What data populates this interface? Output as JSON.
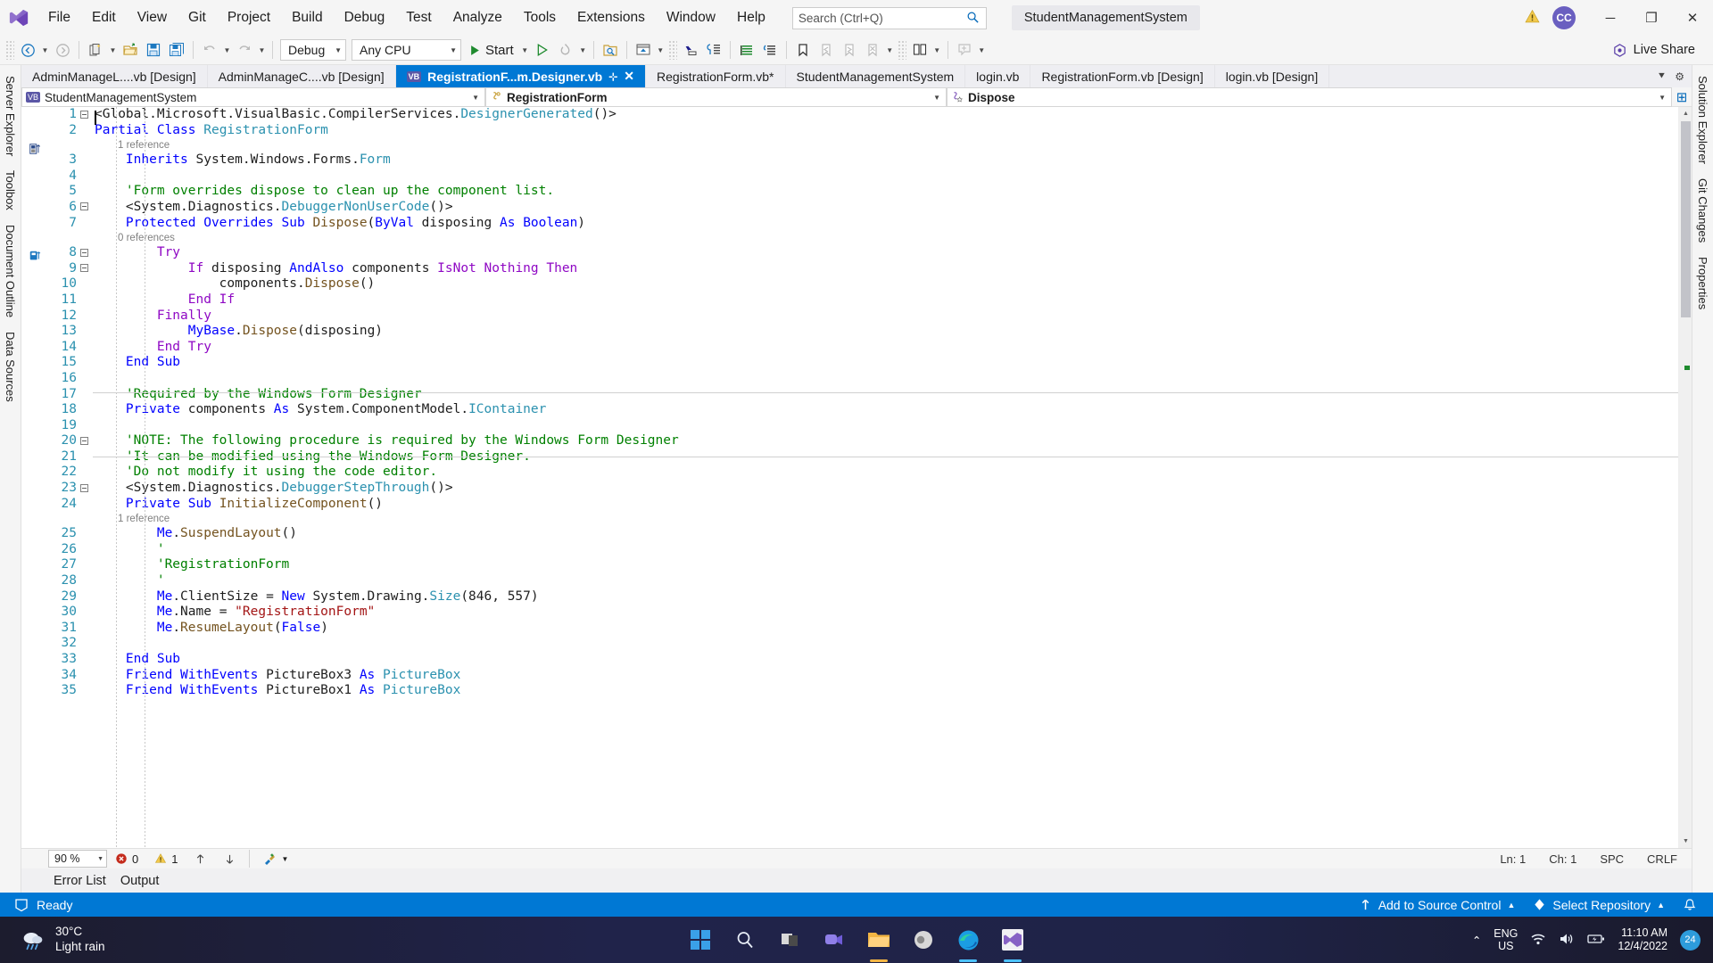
{
  "titlebar": {
    "menus": [
      "File",
      "Edit",
      "View",
      "Git",
      "Project",
      "Build",
      "Debug",
      "Test",
      "Analyze",
      "Tools",
      "Extensions",
      "Window",
      "Help"
    ],
    "search_placeholder": "Search (Ctrl+Q)",
    "solution_name": "StudentManagementSystem",
    "avatar_initials": "CC",
    "minimize": "─",
    "maximize": "❐",
    "close": "✕"
  },
  "toolbar": {
    "config_value": "Debug",
    "platform_value": "Any CPU",
    "start_label": "Start",
    "live_share_label": "Live Share"
  },
  "tabs": [
    {
      "label": "AdminManageL....vb [Design]",
      "active": false,
      "icon": false
    },
    {
      "label": "AdminManageC....vb [Design]",
      "active": false,
      "icon": false
    },
    {
      "label": "RegistrationF...m.Designer.vb",
      "active": true,
      "icon": true
    },
    {
      "label": "RegistrationForm.vb*",
      "active": false,
      "icon": false
    },
    {
      "label": "StudentManagementSystem",
      "active": false,
      "icon": false
    },
    {
      "label": "login.vb",
      "active": false,
      "icon": false
    },
    {
      "label": "RegistrationForm.vb [Design]",
      "active": false,
      "icon": false
    },
    {
      "label": "login.vb [Design]",
      "active": false,
      "icon": false
    }
  ],
  "navbar": {
    "project": "StudentManagementSystem",
    "type": "RegistrationForm",
    "member": "Dispose"
  },
  "left_dock": [
    "Server Explorer",
    "Toolbox",
    "Document Outline",
    "Data Sources"
  ],
  "right_dock": [
    "Solution Explorer",
    "Git Changes",
    "Properties"
  ],
  "editor": {
    "lines": [
      {
        "n": 1,
        "fold": "minus",
        "ref": null,
        "tokens": [
          {
            "t": "<Global.Microsoft.VisualBasic.CompilerServices.",
            "c": "pln"
          },
          {
            "t": "DesignerGenerated",
            "c": "typ"
          },
          {
            "t": "()>",
            "c": "pln"
          }
        ]
      },
      {
        "n": 2,
        "fold": null,
        "ref": "1 reference",
        "tokens": [
          {
            "t": "Partial ",
            "c": "kw"
          },
          {
            "t": "Class ",
            "c": "kw"
          },
          {
            "t": "RegistrationForm",
            "c": "typ"
          }
        ]
      },
      {
        "n": 3,
        "fold": null,
        "ref": null,
        "tokens": [
          {
            "t": "    ",
            "c": "pln"
          },
          {
            "t": "Inherits ",
            "c": "kw"
          },
          {
            "t": "System.Windows.Forms.",
            "c": "pln"
          },
          {
            "t": "Form",
            "c": "typ"
          }
        ]
      },
      {
        "n": 4,
        "fold": null,
        "ref": null,
        "tokens": []
      },
      {
        "n": 5,
        "fold": null,
        "ref": null,
        "tokens": [
          {
            "t": "    'Form overrides dispose to clean up the component list.",
            "c": "cmt"
          }
        ]
      },
      {
        "n": 6,
        "fold": "minus",
        "ref": null,
        "tokens": [
          {
            "t": "    <System.Diagnostics.",
            "c": "pln"
          },
          {
            "t": "DebuggerNonUserCode",
            "c": "typ"
          },
          {
            "t": "()>",
            "c": "pln"
          }
        ]
      },
      {
        "n": 7,
        "fold": null,
        "ref": "0 references",
        "tokens": [
          {
            "t": "    ",
            "c": "pln"
          },
          {
            "t": "Protected Overrides Sub ",
            "c": "kw"
          },
          {
            "t": "Dispose",
            "c": "mth"
          },
          {
            "t": "(",
            "c": "pln"
          },
          {
            "t": "ByVal ",
            "c": "kw"
          },
          {
            "t": "disposing ",
            "c": "pln"
          },
          {
            "t": "As ",
            "c": "kw"
          },
          {
            "t": "Boolean",
            "c": "kw"
          },
          {
            "t": ")",
            "c": "pln"
          }
        ]
      },
      {
        "n": 8,
        "fold": "minus",
        "ref": null,
        "tokens": [
          {
            "t": "        ",
            "c": "pln"
          },
          {
            "t": "Try",
            "c": "kwp"
          }
        ]
      },
      {
        "n": 9,
        "fold": "minus",
        "ref": null,
        "tokens": [
          {
            "t": "            ",
            "c": "pln"
          },
          {
            "t": "If ",
            "c": "kwp"
          },
          {
            "t": "disposing ",
            "c": "pln"
          },
          {
            "t": "AndAlso ",
            "c": "kw"
          },
          {
            "t": "components ",
            "c": "pln"
          },
          {
            "t": "IsNot Nothing Then",
            "c": "kwp"
          }
        ]
      },
      {
        "n": 10,
        "fold": null,
        "ref": null,
        "tokens": [
          {
            "t": "                components.",
            "c": "pln"
          },
          {
            "t": "Dispose",
            "c": "mth"
          },
          {
            "t": "()",
            "c": "pln"
          }
        ]
      },
      {
        "n": 11,
        "fold": null,
        "ref": null,
        "tokens": [
          {
            "t": "            ",
            "c": "pln"
          },
          {
            "t": "End If",
            "c": "kwp"
          }
        ]
      },
      {
        "n": 12,
        "fold": null,
        "ref": null,
        "tokens": [
          {
            "t": "        ",
            "c": "pln"
          },
          {
            "t": "Finally",
            "c": "kwp"
          }
        ]
      },
      {
        "n": 13,
        "fold": null,
        "ref": null,
        "tokens": [
          {
            "t": "            ",
            "c": "pln"
          },
          {
            "t": "MyBase",
            "c": "kw"
          },
          {
            "t": ".",
            "c": "pln"
          },
          {
            "t": "Dispose",
            "c": "mth"
          },
          {
            "t": "(disposing)",
            "c": "pln"
          }
        ]
      },
      {
        "n": 14,
        "fold": null,
        "ref": null,
        "tokens": [
          {
            "t": "        ",
            "c": "pln"
          },
          {
            "t": "End Try",
            "c": "kwp"
          }
        ]
      },
      {
        "n": 15,
        "fold": null,
        "ref": null,
        "tokens": [
          {
            "t": "    ",
            "c": "pln"
          },
          {
            "t": "End Sub",
            "c": "kw"
          }
        ]
      },
      {
        "n": 16,
        "fold": null,
        "ref": null,
        "tokens": []
      },
      {
        "n": 17,
        "fold": null,
        "ref": null,
        "tokens": [
          {
            "t": "    'Required by the Windows Form Designer",
            "c": "cmt"
          }
        ]
      },
      {
        "n": 18,
        "fold": null,
        "ref": null,
        "tokens": [
          {
            "t": "    ",
            "c": "pln"
          },
          {
            "t": "Private ",
            "c": "kw"
          },
          {
            "t": "components ",
            "c": "pln"
          },
          {
            "t": "As ",
            "c": "kw"
          },
          {
            "t": "System.ComponentModel.",
            "c": "pln"
          },
          {
            "t": "IContainer",
            "c": "typ"
          }
        ]
      },
      {
        "n": 19,
        "fold": null,
        "ref": null,
        "tokens": []
      },
      {
        "n": 20,
        "fold": "minus",
        "ref": null,
        "tokens": [
          {
            "t": "    'NOTE: The following procedure is required by the Windows Form Designer",
            "c": "cmt"
          }
        ]
      },
      {
        "n": 21,
        "fold": null,
        "ref": null,
        "tokens": [
          {
            "t": "    'It can be modified using the Windows Form Designer.",
            "c": "cmt"
          }
        ]
      },
      {
        "n": 22,
        "fold": null,
        "ref": null,
        "tokens": [
          {
            "t": "    'Do not modify it using the code editor.",
            "c": "cmt"
          }
        ]
      },
      {
        "n": 23,
        "fold": "minus",
        "ref": null,
        "tokens": [
          {
            "t": "    <System.Diagnostics.",
            "c": "pln"
          },
          {
            "t": "DebuggerStepThrough",
            "c": "typ"
          },
          {
            "t": "()>",
            "c": "pln"
          }
        ]
      },
      {
        "n": 24,
        "fold": null,
        "ref": "1 reference",
        "tokens": [
          {
            "t": "    ",
            "c": "pln"
          },
          {
            "t": "Private Sub ",
            "c": "kw"
          },
          {
            "t": "InitializeComponent",
            "c": "mth"
          },
          {
            "t": "()",
            "c": "pln"
          }
        ]
      },
      {
        "n": 25,
        "fold": null,
        "ref": null,
        "tokens": [
          {
            "t": "        ",
            "c": "pln"
          },
          {
            "t": "Me",
            "c": "kw"
          },
          {
            "t": ".",
            "c": "pln"
          },
          {
            "t": "SuspendLayout",
            "c": "mth"
          },
          {
            "t": "()",
            "c": "pln"
          }
        ]
      },
      {
        "n": 26,
        "fold": null,
        "ref": null,
        "tokens": [
          {
            "t": "        '",
            "c": "cmt"
          }
        ]
      },
      {
        "n": 27,
        "fold": null,
        "ref": null,
        "tokens": [
          {
            "t": "        'RegistrationForm",
            "c": "cmt"
          }
        ]
      },
      {
        "n": 28,
        "fold": null,
        "ref": null,
        "tokens": [
          {
            "t": "        '",
            "c": "cmt"
          }
        ]
      },
      {
        "n": 29,
        "fold": null,
        "ref": null,
        "tokens": [
          {
            "t": "        ",
            "c": "pln"
          },
          {
            "t": "Me",
            "c": "kw"
          },
          {
            "t": ".ClientSize = ",
            "c": "pln"
          },
          {
            "t": "New ",
            "c": "kw"
          },
          {
            "t": "System.Drawing.",
            "c": "pln"
          },
          {
            "t": "Size",
            "c": "typ"
          },
          {
            "t": "(846, 557)",
            "c": "pln"
          }
        ]
      },
      {
        "n": 30,
        "fold": null,
        "ref": null,
        "tokens": [
          {
            "t": "        ",
            "c": "pln"
          },
          {
            "t": "Me",
            "c": "kw"
          },
          {
            "t": ".Name = ",
            "c": "pln"
          },
          {
            "t": "\"RegistrationForm\"",
            "c": "str"
          }
        ]
      },
      {
        "n": 31,
        "fold": null,
        "ref": null,
        "tokens": [
          {
            "t": "        ",
            "c": "pln"
          },
          {
            "t": "Me",
            "c": "kw"
          },
          {
            "t": ".",
            "c": "pln"
          },
          {
            "t": "ResumeLayout",
            "c": "mth"
          },
          {
            "t": "(",
            "c": "pln"
          },
          {
            "t": "False",
            "c": "kw"
          },
          {
            "t": ")",
            "c": "pln"
          }
        ]
      },
      {
        "n": 32,
        "fold": null,
        "ref": null,
        "tokens": []
      },
      {
        "n": 33,
        "fold": null,
        "ref": null,
        "tokens": [
          {
            "t": "    ",
            "c": "pln"
          },
          {
            "t": "End Sub",
            "c": "kw"
          }
        ]
      },
      {
        "n": 34,
        "fold": null,
        "ref": null,
        "tokens": [
          {
            "t": "    ",
            "c": "pln"
          },
          {
            "t": "Friend WithEvents ",
            "c": "kw"
          },
          {
            "t": "PictureBox3 ",
            "c": "pln"
          },
          {
            "t": "As ",
            "c": "kw"
          },
          {
            "t": "PictureBox",
            "c": "typ"
          }
        ]
      },
      {
        "n": 35,
        "fold": null,
        "ref": null,
        "tokens": [
          {
            "t": "    ",
            "c": "pln"
          },
          {
            "t": "Friend WithEvents ",
            "c": "kw"
          },
          {
            "t": "PictureBox1 ",
            "c": "pln"
          },
          {
            "t": "As ",
            "c": "kw"
          },
          {
            "t": "PictureBox",
            "c": "typ"
          }
        ]
      }
    ]
  },
  "editor_status": {
    "zoom": "90 %",
    "error_count": "0",
    "warning_count": "1",
    "ln": "Ln: 1",
    "ch": "Ch: 1",
    "spc": "SPC",
    "eol": "CRLF"
  },
  "panel_tabs": [
    "Error List",
    "Output"
  ],
  "vs_status": {
    "ready": "Ready",
    "source_control": "Add to Source Control",
    "repository": "Select Repository"
  },
  "taskbar": {
    "temperature": "30°C",
    "condition": "Light rain",
    "language_line1": "ENG",
    "language_line2": "US",
    "time": "11:10 AM",
    "date": "12/4/2022",
    "notification_count": "24"
  },
  "colors": {
    "accent": "#0078d4",
    "tab_active_bg": "#0078d4",
    "keyword": "#0000ff",
    "keyword_control": "#8f08c4",
    "type": "#2b91af",
    "comment": "#008000",
    "string": "#a31515",
    "method": "#74531f",
    "linenum": "#2b91af"
  }
}
